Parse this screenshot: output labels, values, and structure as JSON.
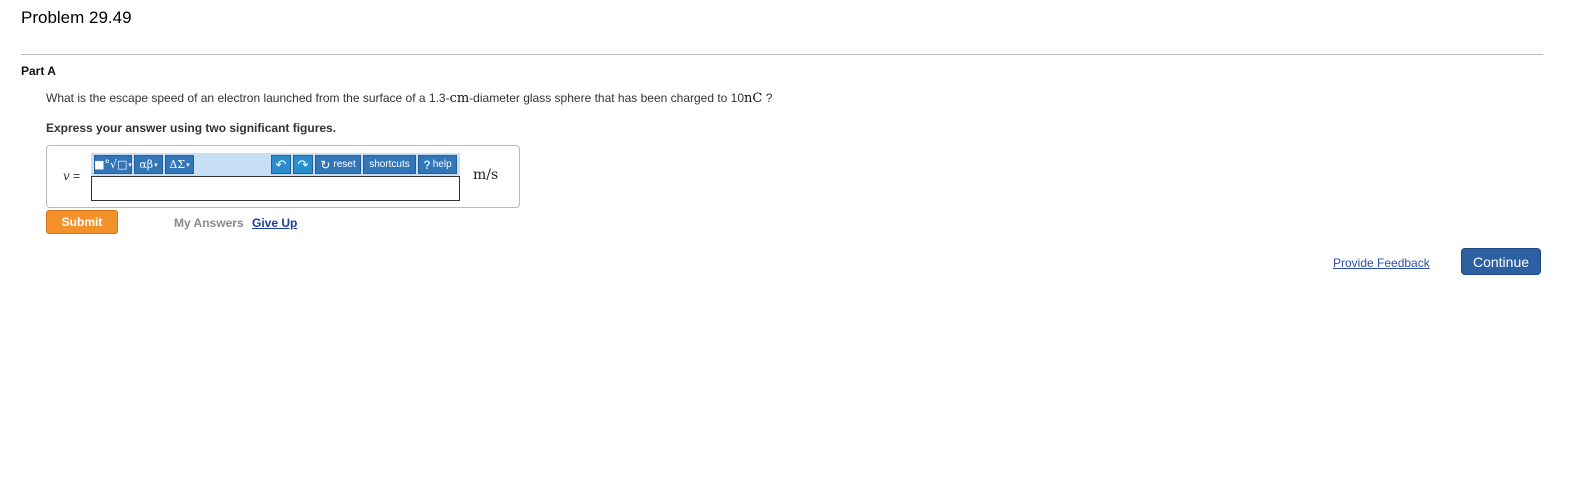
{
  "problem": {
    "title": "Problem 29.49"
  },
  "part": {
    "label": "Part A",
    "question_before": "What is the escape speed of an electron launched from the surface of a 1.3-",
    "question_unit1": "cm",
    "question_mid": "-diameter glass sphere that has been charged to 10",
    "question_unit2": "nC",
    "question_after": " ?",
    "instruction": "Express your answer using two significant figures."
  },
  "answer": {
    "variable": "v",
    "equals": " =",
    "value": "",
    "placeholder": "",
    "unit": "m/s"
  },
  "toolbar": {
    "templates_label": "■°√□",
    "greek_label": "αβ",
    "symbols_label": "ΔΣ",
    "undo_label": "↶",
    "redo_label": "↷",
    "reset_label": "reset",
    "reset_icon": "↻",
    "shortcuts_label": "shortcuts",
    "help_icon": "?",
    "help_label": "help",
    "dropdown_marker": "▾"
  },
  "actions": {
    "submit_label": "Submit",
    "my_answers_label": "My Answers",
    "give_up_label": "Give Up",
    "provide_feedback_label": "Provide Feedback",
    "continue_label": "Continue"
  },
  "colors": {
    "submit": "#f3922b",
    "continue": "#2d5fa3",
    "toolbar_bg": "#c6dff5",
    "toolbar_button": "#3376b8"
  }
}
